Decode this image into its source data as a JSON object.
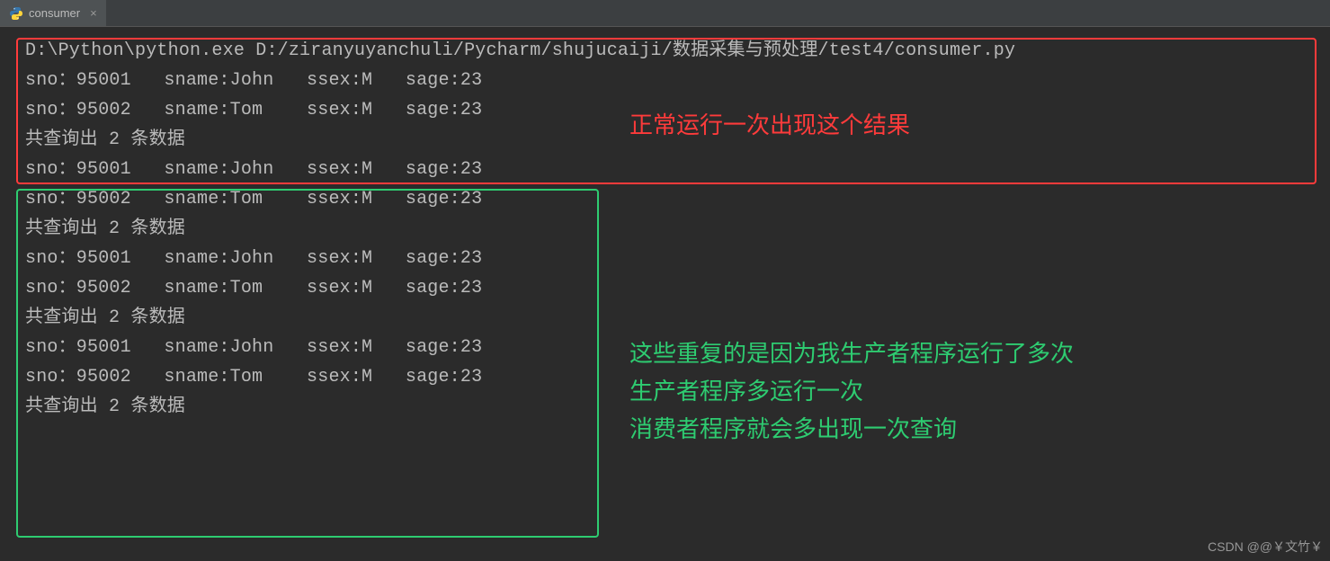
{
  "tab": {
    "label": "consumer",
    "close": "×"
  },
  "console": {
    "cmd": "D:\\Python\\python.exe D:/ziranyuyanchuli/Pycharm/shujucaiji/数据采集与预处理/test4/consumer.py",
    "row1": "sno：95001   sname:John   ssex:M   sage:23",
    "row2": "sno：95002   sname:Tom    ssex:M   sage:23",
    "summary": "共查询出 2 条数据"
  },
  "annotations": {
    "red": "正常运行一次出现这个结果",
    "green": "这些重复的是因为我生产者程序运行了多次\n生产者程序多运行一次\n消费者程序就会多出现一次查询"
  },
  "watermark": "CSDN @@￥文竹￥"
}
